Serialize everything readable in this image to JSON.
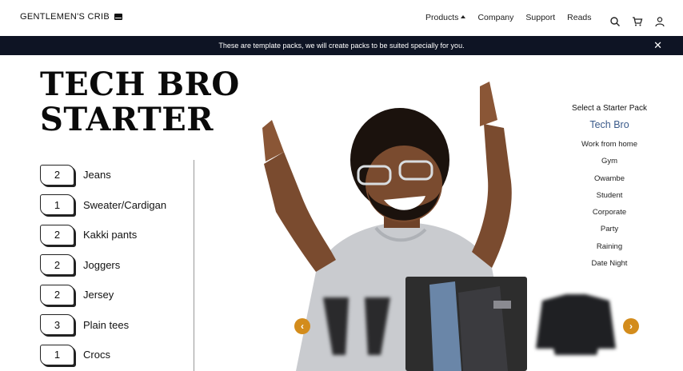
{
  "brand": {
    "name": "GENTLEMEN'S CRIB"
  },
  "nav": {
    "items": [
      "Products",
      "Company",
      "Support",
      "Reads"
    ]
  },
  "banner": {
    "text": "These are template packs, we will create packs to be suited specially for you."
  },
  "hero": {
    "title_line1": "TECH BRO",
    "title_line2": "STARTER"
  },
  "items": [
    {
      "qty": "2",
      "label": "Jeans"
    },
    {
      "qty": "1",
      "label": "Sweater/Cardigan"
    },
    {
      "qty": "2",
      "label": "Kakki pants"
    },
    {
      "qty": "2",
      "label": "Joggers"
    },
    {
      "qty": "2",
      "label": "Jersey"
    },
    {
      "qty": "3",
      "label": "Plain tees"
    },
    {
      "qty": "1",
      "label": "Crocs"
    }
  ],
  "packs": {
    "heading": "Select a Starter Pack",
    "active": "Tech Bro",
    "list": [
      "Work from home",
      "Gym",
      "Owambe",
      "Student",
      "Corporate",
      "Party",
      "Raining",
      "Date Night"
    ]
  },
  "colors": {
    "banner_bg": "#0e1424",
    "accent": "#d38c1c",
    "active_pack": "#3a5a8a"
  },
  "icons": {
    "search": "search-icon",
    "cart": "cart-icon",
    "user": "user-icon",
    "close": "close-icon",
    "prev": "chevron-left-icon",
    "next": "chevron-right-icon"
  }
}
